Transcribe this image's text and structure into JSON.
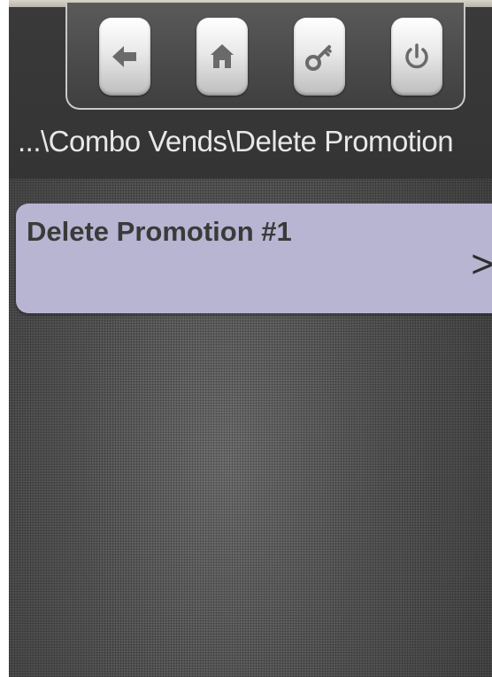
{
  "nav": {
    "buttons": [
      {
        "id": "back",
        "icon": "arrow-left-icon"
      },
      {
        "id": "home",
        "icon": "home-icon"
      },
      {
        "id": "service",
        "icon": "key-icon"
      },
      {
        "id": "power",
        "icon": "power-icon"
      }
    ]
  },
  "breadcrumb": "...\\Combo Vends\\Delete Promotion",
  "menu": {
    "items": [
      {
        "label": "Delete Promotion #1",
        "arrow": ">"
      }
    ]
  },
  "colors": {
    "menu_item_bg": "#b7b5d2",
    "background": "#4a4a4a",
    "text": "#e8e8e8"
  }
}
